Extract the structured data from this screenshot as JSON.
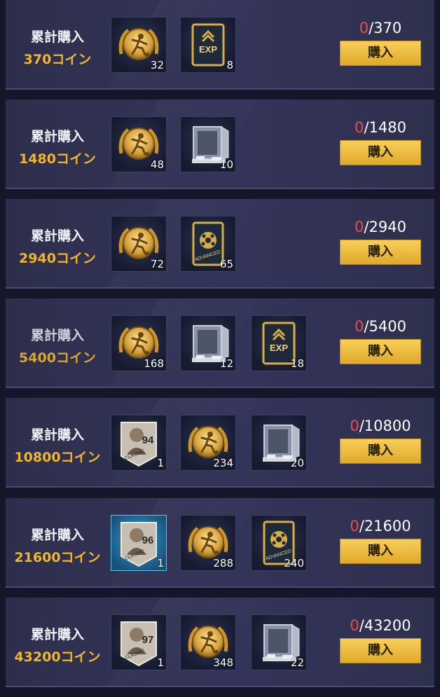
{
  "rows": [
    {
      "title": "累計購入",
      "amount": "370コイン",
      "current": "0",
      "target": "/370",
      "buy_label": "購入",
      "items": [
        {
          "icon": "gold-coin-icon",
          "count": "32"
        },
        {
          "icon": "exp-card-icon",
          "count": "8"
        }
      ]
    },
    {
      "title": "累計購入",
      "amount": "1480コイン",
      "current": "0",
      "target": "/1480",
      "buy_label": "購入",
      "items": [
        {
          "icon": "gold-coin-icon",
          "count": "48"
        },
        {
          "icon": "safe-box-icon",
          "count": "10"
        }
      ]
    },
    {
      "title": "累計購入",
      "amount": "2940コイン",
      "current": "0",
      "target": "/2940",
      "buy_label": "購入",
      "items": [
        {
          "icon": "gold-coin-icon",
          "count": "72"
        },
        {
          "icon": "advanced-ball-card-icon",
          "count": "65",
          "card_text": "ADVANCED"
        }
      ]
    },
    {
      "title": "累計購入",
      "amount": "5400コイン",
      "current": "0",
      "target": "/5400",
      "buy_label": "購入",
      "items": [
        {
          "icon": "gold-coin-icon",
          "count": "168"
        },
        {
          "icon": "safe-box-icon",
          "count": "12"
        },
        {
          "icon": "exp-card-icon",
          "count": "18"
        }
      ]
    },
    {
      "title": "累計購入",
      "amount": "10800コイン",
      "current": "0",
      "target": "/10800",
      "buy_label": "購入",
      "items": [
        {
          "icon": "classic-player-card-icon",
          "count": "1",
          "rating": "94",
          "card_text": "CLASSIC"
        },
        {
          "icon": "gold-coin-icon",
          "count": "234"
        },
        {
          "icon": "safe-box-icon",
          "count": "20"
        }
      ]
    },
    {
      "title": "累計購入",
      "amount": "21600コイン",
      "current": "0",
      "target": "/21600",
      "buy_label": "購入",
      "items": [
        {
          "icon": "classic-player-card-icon",
          "count": "1",
          "rating": "96",
          "card_text": "CLASSIC"
        },
        {
          "icon": "gold-coin-icon",
          "count": "288"
        },
        {
          "icon": "advanced-ball-card-icon",
          "count": "240",
          "card_text": "ADVANCED"
        }
      ]
    },
    {
      "title": "累計購入",
      "amount": "43200コイン",
      "current": "0",
      "target": "/43200",
      "buy_label": "購入",
      "items": [
        {
          "icon": "classic-player-card-icon",
          "count": "1",
          "rating": "97",
          "card_text": "CLASSIC"
        },
        {
          "icon": "gold-coin-icon",
          "count": "348"
        },
        {
          "icon": "safe-box-icon",
          "count": "22"
        }
      ]
    }
  ],
  "exp_text": "EXP",
  "colors": {
    "accent_gold": "#f2b52a",
    "progress_red": "#e05050",
    "button_gold": "#f0c040"
  }
}
